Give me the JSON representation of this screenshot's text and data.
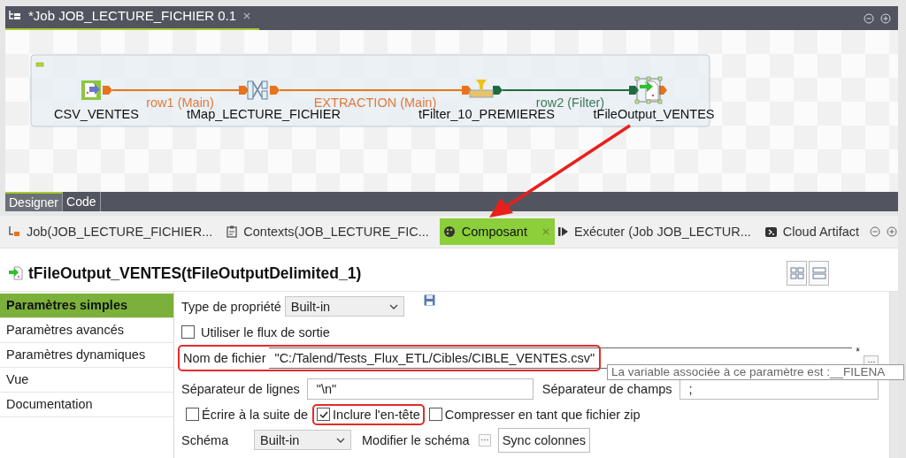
{
  "editor": {
    "title": "*Job JOB_LECTURE_FICHIER 0.1"
  },
  "diagram": {
    "nodes": [
      {
        "label": "CSV_VENTES",
        "kind": "csv",
        "selected": false
      },
      {
        "label": "tMap_LECTURE_FICHIER",
        "kind": "tmap",
        "selected": false
      },
      {
        "label": "tFilter_10_PREMIERES",
        "kind": "filter",
        "selected": false
      },
      {
        "label": "tFileOutput_VENTES",
        "kind": "output",
        "selected": true
      }
    ],
    "links": [
      {
        "label": "row1 (Main)",
        "kind": "main"
      },
      {
        "label": "EXTRACTION (Main)",
        "kind": "main"
      },
      {
        "label": "row2 (Filter)",
        "kind": "filter"
      }
    ]
  },
  "view_tabs": [
    {
      "label": "Designer",
      "selected": true
    },
    {
      "label": "Code",
      "selected": false
    }
  ],
  "property_tabs": [
    {
      "label": "Job(JOB_LECTURE_FICHIER...",
      "kind": "job",
      "selected": false
    },
    {
      "label": "Contexts(JOB_LECTURE_FIC...",
      "kind": "contexts",
      "selected": false
    },
    {
      "label": "Composant",
      "kind": "component",
      "selected": true
    },
    {
      "label": "Exécuter (Job JOB_LECTUR...",
      "kind": "run",
      "selected": false
    },
    {
      "label": "Cloud Artifact",
      "kind": "cloud",
      "selected": false
    }
  ],
  "component_title": "tFileOutput_VENTES(tFileOutputDelimited_1)",
  "sidebar": [
    {
      "label": "Paramètres simples",
      "selected": true
    },
    {
      "label": "Paramètres avancés",
      "selected": false
    },
    {
      "label": "Paramètres dynamiques",
      "selected": false
    },
    {
      "label": "Vue",
      "selected": false
    },
    {
      "label": "Documentation",
      "selected": false
    }
  ],
  "form": {
    "property_type": {
      "label": "Type de propriété",
      "value": "Built-in"
    },
    "use_output_stream": {
      "label": "Utiliser le flux de sortie",
      "checked": false
    },
    "file_name": {
      "label": "Nom de fichier",
      "value": "\"C:/Talend/Tests_Flux_ETL/Cibles/CIBLE_VENTES.csv\"",
      "required_mark": "*",
      "highlighted": true
    },
    "row_separator": {
      "label": "Séparateur de lignes",
      "value": "\"\\n\""
    },
    "field_separator": {
      "label": "Séparateur de champs",
      "value": ";"
    },
    "options": [
      {
        "label": "Écrire à la suite de",
        "checked": false
      },
      {
        "label": "Inclure l'en-tête",
        "checked": true,
        "highlighted": true
      },
      {
        "label": "Compresser en tant que fichier zip",
        "checked": false
      }
    ],
    "schema": {
      "label": "Schéma",
      "value": "Built-in",
      "edit_label": "Modifier le schéma",
      "sync_button": "Sync colonnes"
    }
  },
  "tooltip": "La variable associée à ce paramètre est :__FILENA"
}
